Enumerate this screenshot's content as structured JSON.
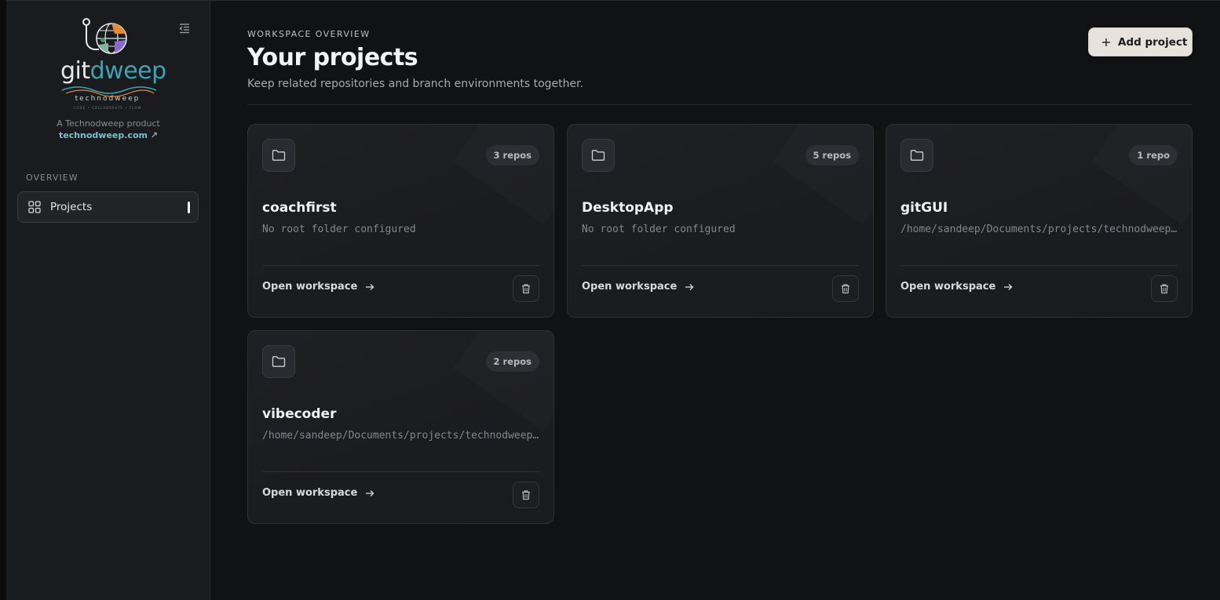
{
  "brand": {
    "logo_git": "git",
    "logo_dweep": "dweep",
    "logo_sub": "technodweep",
    "logo_tagline": "CODE • COLLABORATE • FLOW",
    "product_text": "A Technodweep product",
    "product_link": "technodweep.com ↗"
  },
  "sidebar": {
    "section_label": "OVERVIEW",
    "items": [
      {
        "label": "Projects",
        "icon": "grid-icon",
        "active": true
      }
    ]
  },
  "header": {
    "overline": "WORKSPACE OVERVIEW",
    "title": "Your projects",
    "description": "Keep related repositories and branch environments together.",
    "add_button": "Add project"
  },
  "projects": [
    {
      "name": "coachfirst",
      "repos": "3 repos",
      "path": "No root folder configured",
      "action": "Open workspace"
    },
    {
      "name": "DesktopApp",
      "repos": "5 repos",
      "path": "No root folder configured",
      "action": "Open workspace"
    },
    {
      "name": "gitGUI",
      "repos": "1 repo",
      "path": "/home/sandeep/Documents/projects/technodweep/gitGUI",
      "action": "Open workspace"
    },
    {
      "name": "vibecoder",
      "repos": "2 repos",
      "path": "/home/sandeep/Documents/projects/technodweep/vibecoder",
      "action": "Open workspace"
    }
  ],
  "colors": {
    "background": "#111214",
    "sidebar": "#1a1b1e",
    "accent": "#3ea3b2",
    "add_button": "#e7e3dc"
  }
}
